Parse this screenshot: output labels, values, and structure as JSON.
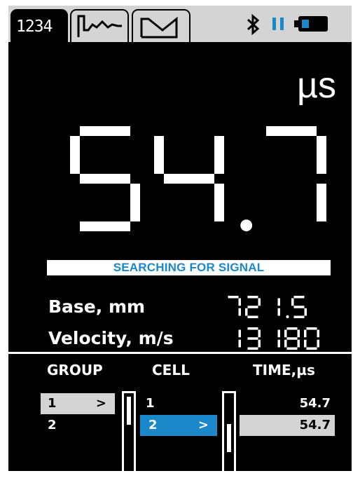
{
  "tabs": [
    {
      "label": "1234",
      "icon": "numeric-display-icon",
      "active": true
    },
    {
      "label": "",
      "icon": "waveform-icon",
      "active": false
    },
    {
      "label": "",
      "icon": "pulse-icon",
      "active": false
    }
  ],
  "status": {
    "bluetooth_icon": "bluetooth-icon",
    "pause_icon": "pause-icon",
    "battery_icon": "battery-icon",
    "accent": "#1a88c9"
  },
  "reading": {
    "unit": "µs",
    "value": "54.7"
  },
  "signal_status": "SEARCHING FOR SIGNAL",
  "measurements": {
    "base_label": "Base, mm",
    "base_value": "721.5",
    "velocity_label": "Velocity, m/s",
    "velocity_value": "13180"
  },
  "table": {
    "headers": {
      "group": "GROUP",
      "cell": "CELL",
      "time": "TIME,µs"
    },
    "groups": [
      {
        "label": "1",
        "arrow": ">",
        "selected": true
      },
      {
        "label": "2",
        "arrow": "",
        "selected": false
      }
    ],
    "cells": [
      {
        "label": "1",
        "arrow": "",
        "selected": false,
        "time": "54.7"
      },
      {
        "label": "2",
        "arrow": ">",
        "selected": true,
        "time": "54.7"
      }
    ]
  }
}
